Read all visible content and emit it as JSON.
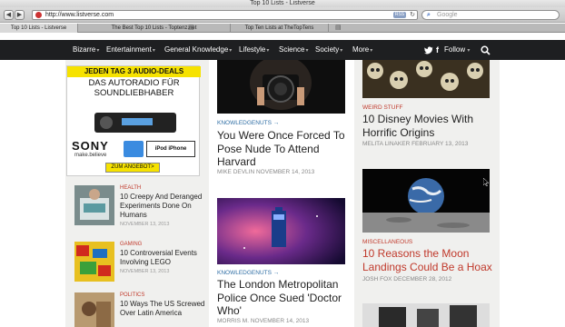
{
  "browser": {
    "window_title": "Top 10 Lists - Listverse",
    "url": "http://www.listverse.com",
    "search_placeholder": "Google",
    "rss_label": "RSS",
    "tabs": [
      {
        "label": "Top 10 Lists - Listverse",
        "active": true
      },
      {
        "label": "The Best Top 10 Lists - Toptenz.net",
        "active": false
      },
      {
        "label": "Top Ten Lists at TheTopTens",
        "active": false
      }
    ]
  },
  "nav": {
    "items": [
      "Bizarre",
      "Entertainment",
      "General Knowledge",
      "Lifestyle",
      "Science",
      "Society",
      "More"
    ],
    "follow_label": "Follow"
  },
  "ad": {
    "headline": "JEDEN TAG 3 AUDIO-DEALS",
    "sub1": "DAS AUTORADIO FÜR",
    "sub2": "SOUNDLIEBHABER",
    "brand": "SONY",
    "tagline": "make.believe",
    "compat": "iPod  iPhone",
    "cta": "ZUM ANGEBOT>"
  },
  "sidebar": [
    {
      "category": "Health",
      "title": "10 Creepy And Deranged Experiments Done On Humans",
      "date": "November 13, 2013"
    },
    {
      "category": "Gaming",
      "title": "10 Controversial Events Involving LEGO",
      "date": "November 13, 2013"
    },
    {
      "category": "Politics",
      "title": "10 Ways The US Screwed Over Latin America",
      "date": ""
    }
  ],
  "main": [
    {
      "category": "Knowledgenuts →",
      "title": "You Were Once Forced To Pose Nude To Attend Harvard",
      "byline": "Mike Devlin November 14, 2013"
    },
    {
      "category": "Knowledgenuts →",
      "title": "The London Metropolitan Police Once Sued 'Doctor Who'",
      "byline": "Morris M. November 14, 2013"
    }
  ],
  "right": [
    {
      "category": "Weird Stuff",
      "title": "10 Disney Movies With Horrific Origins",
      "byline": "Melita Linaker February 13, 2013"
    },
    {
      "category": "Miscellaneous",
      "title": "10 Reasons the Moon Landings Could Be a Hoax",
      "byline": "Josh Fox December 28, 2012"
    }
  ],
  "colors": {
    "nav_bg": "#1e1f21",
    "accent_red": "#c0392b",
    "accent_blue": "#2e6da4"
  }
}
